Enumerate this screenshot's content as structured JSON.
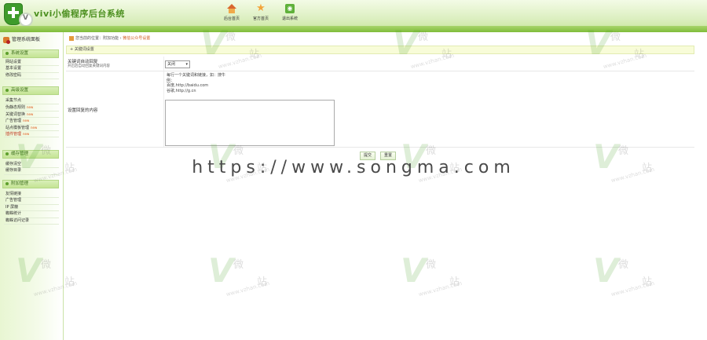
{
  "header": {
    "brand": "vivi小偷程序后台系统",
    "logo_letter": "V",
    "nav": [
      {
        "label": "后台首页",
        "icon": "home-icon"
      },
      {
        "label": "官方首页",
        "icon": "star-icon"
      },
      {
        "label": "退出系统",
        "icon": "rss-icon"
      }
    ]
  },
  "sidebar": {
    "title": "管理系统面板",
    "groups": [
      {
        "title": "系统设置",
        "items": [
          {
            "label": "网站设置",
            "new": "",
            "active": false
          },
          {
            "label": "基本设置",
            "new": "",
            "active": false
          },
          {
            "label": "修改密码",
            "new": "",
            "active": false
          }
        ]
      },
      {
        "title": "高级设置",
        "items": [
          {
            "label": "采集节点",
            "new": "",
            "active": false
          },
          {
            "label": "伪静态规则",
            "new": "new",
            "active": false
          },
          {
            "label": "关键词替换",
            "new": "new",
            "active": false
          },
          {
            "label": "广告管理",
            "new": "new",
            "active": false
          },
          {
            "label": "站点模板管理",
            "new": "new",
            "active": false
          },
          {
            "label": "插件管理",
            "new": "new",
            "active": true
          }
        ]
      },
      {
        "title": "缓存管理",
        "items": [
          {
            "label": "缓存清空",
            "new": "",
            "active": false
          },
          {
            "label": "缓存目录",
            "new": "",
            "active": false
          }
        ]
      },
      {
        "title": "附加管理",
        "items": [
          {
            "label": "友情链接",
            "new": "",
            "active": false
          },
          {
            "label": "广告管理",
            "new": "",
            "active": false
          },
          {
            "label": "IP 屏蔽",
            "new": "",
            "active": false
          },
          {
            "label": "蜘蛛统计",
            "new": "",
            "active": false
          },
          {
            "label": "蜘蛛访问记录",
            "new": "",
            "active": false
          }
        ]
      }
    ]
  },
  "breadcrumb": {
    "prefix": "您当前的位置：",
    "middle": "附加功能 ›",
    "current": "微信公众号设置"
  },
  "panel": {
    "header": "+ 关键词设置",
    "row1": {
      "label": "关键词自动回复",
      "sublabel": "开启后自动回复关键词内容",
      "select_value": "关闭"
    },
    "row2": {
      "label": "设置回复的内容",
      "reply_lines": [
        "每行一个关键词和链接，如：搜牛",
        "例：",
        "百度,http://baidu.com",
        "谷歌,http://g.cn"
      ],
      "textarea_value": ""
    },
    "buttons": {
      "save": "提交",
      "reset": "重置"
    }
  },
  "watermark": {
    "url": "https://www.songma.com",
    "mark_v": "V",
    "mark_cn1": "微",
    "mark_cn2": "站",
    "mark_url": "www.vzhan.com"
  }
}
